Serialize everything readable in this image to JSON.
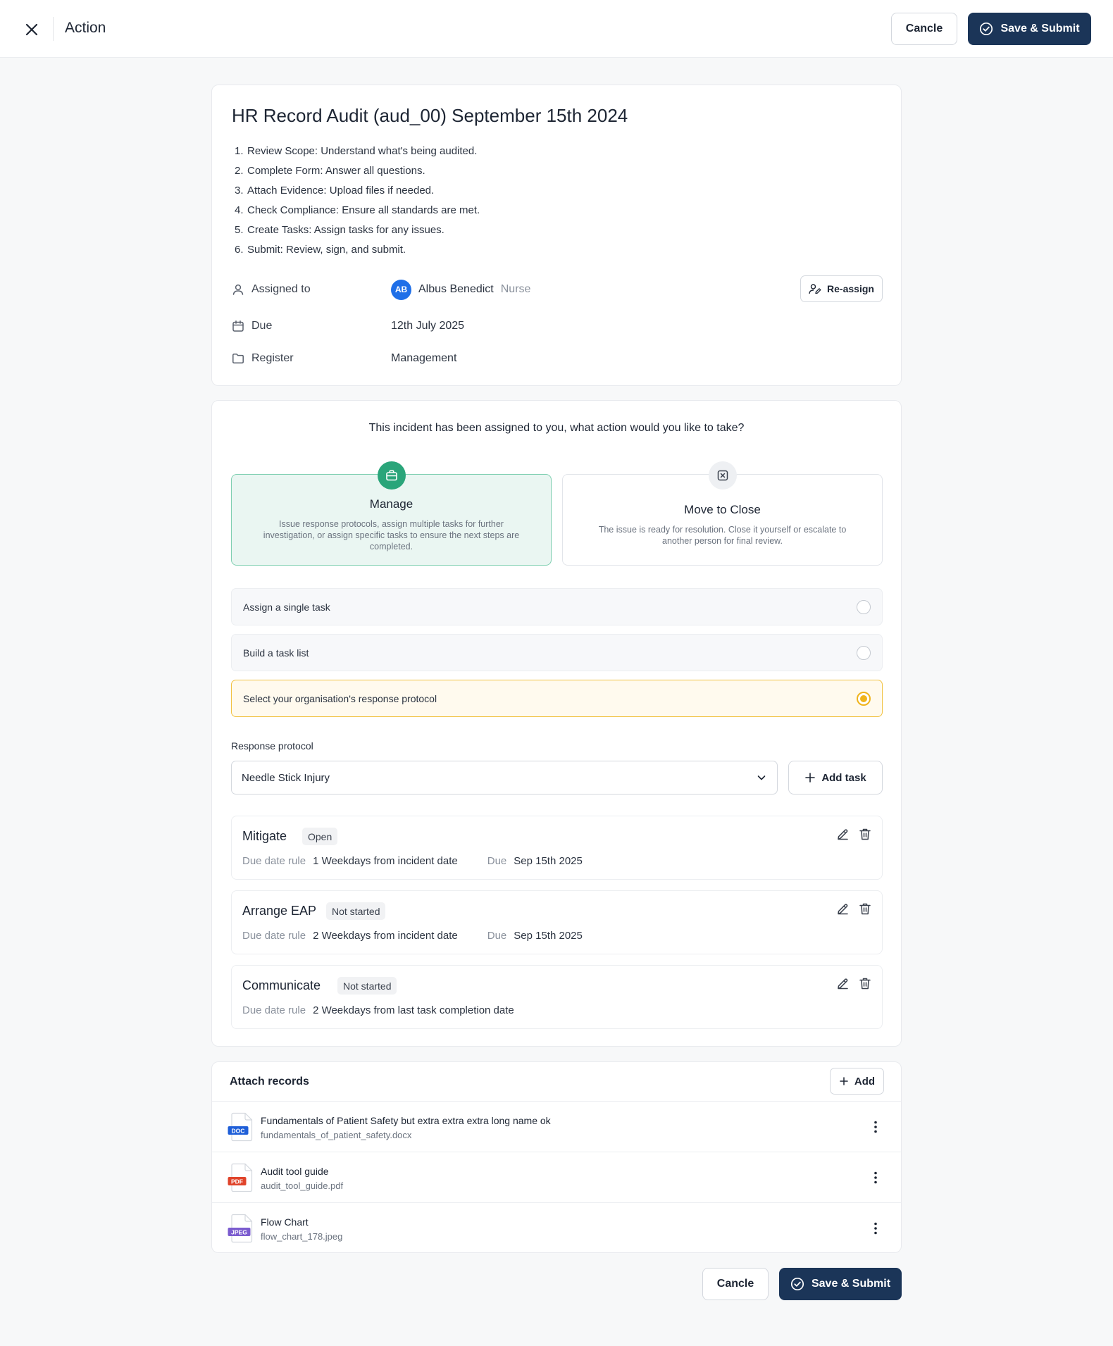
{
  "header": {
    "title": "Action",
    "cancel_label": "Cancle",
    "submit_label": "Save & Submit"
  },
  "audit": {
    "title": "HR Record Audit (aud_00) September 15th 2024",
    "steps": [
      "Review Scope: Understand what's being audited.",
      "Complete Form: Answer all questions.",
      "Attach Evidence: Upload files if needed.",
      "Check Compliance: Ensure all standards are met.",
      "Create Tasks: Assign tasks for any issues.",
      "Submit: Review, sign, and submit."
    ],
    "assigned_label": "Assigned to",
    "assignee_initials": "AB",
    "assignee_name": "Albus Benedict",
    "assignee_role": "Nurse",
    "reassign_label": "Re-assign",
    "due_label": "Due",
    "due_value": "12th July 2025",
    "register_label": "Register",
    "register_value": "Management"
  },
  "action": {
    "question": "This incident has been assigned to you, what action would you like to take?",
    "options": [
      {
        "title": "Manage",
        "desc": "Issue response protocols, assign multiple tasks for further investigation, or assign specific tasks to ensure the next steps are completed."
      },
      {
        "title": "Move to Close",
        "desc": "The issue is ready for resolution. Close it yourself or escalate to another person for final review."
      }
    ],
    "radio_options": [
      "Assign a single task",
      "Build a task list",
      "Select your organisation's response protocol"
    ],
    "protocol_label": "Response protocol",
    "protocol_value": "Needle Stick Injury",
    "add_task_label": "Add task",
    "tasks": [
      {
        "name": "Mitigate",
        "status": "Open",
        "rule_label": "Due date rule",
        "rule_value": "1 Weekdays from incident date",
        "due_label": "Due",
        "due_value": "Sep 15th 2025"
      },
      {
        "name": "Arrange EAP",
        "status": "Not started",
        "rule_label": "Due date rule",
        "rule_value": "2 Weekdays from incident date",
        "due_label": "Due",
        "due_value": "Sep 15th 2025"
      },
      {
        "name": "Communicate",
        "status": "Not started",
        "rule_label": "Due date rule",
        "rule_value": "2 Weekdays from last task completion date"
      }
    ]
  },
  "attachments": {
    "title": "Attach records",
    "add_label": "Add",
    "records": [
      {
        "name": "Fundamentals of Patient Safety but extra extra extra long name ok",
        "file": "fundamentals_of_patient_safety.docx",
        "type": "DOC",
        "color": "#1f5fd8"
      },
      {
        "name": "Audit tool guide",
        "file": "audit_tool_guide.pdf",
        "type": "PDF",
        "color": "#e0442b"
      },
      {
        "name": "Flow Chart",
        "file": "flow_chart_178.jpeg",
        "type": "JPEG",
        "color": "#7b5ccf"
      }
    ]
  },
  "footer": {
    "cancel_label": "Cancle",
    "submit_label": "Save & Submit"
  },
  "colors": {
    "primary": "#1b3558",
    "manage_selected": "#2aa57a",
    "radio_active": "#f0b41c",
    "avatar": "#1f6fe8"
  }
}
